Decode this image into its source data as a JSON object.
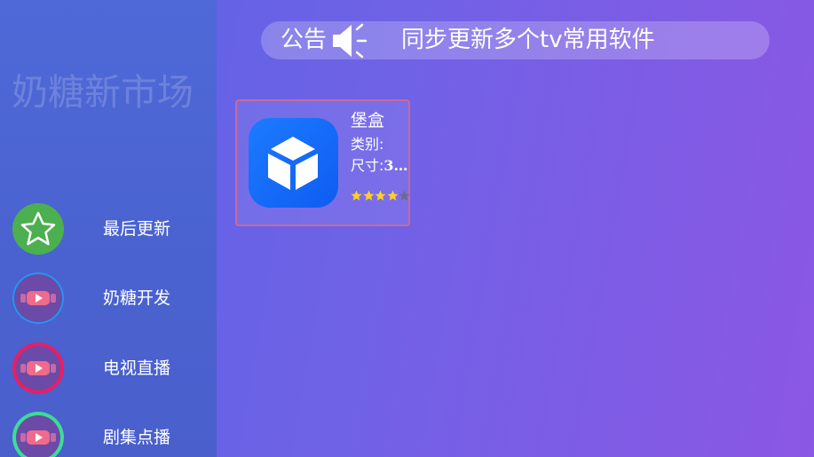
{
  "sidebar": {
    "store_title": "奶糖新市场",
    "items": [
      {
        "label": "最后更新",
        "icon": "star-icon",
        "ring": "#4caf50"
      },
      {
        "label": "奶糖开发",
        "icon": "video-play-icon",
        "ring": "#2196f3"
      },
      {
        "label": "电视直播",
        "icon": "video-play-icon",
        "ring": "#e91e63"
      },
      {
        "label": "剧集点播",
        "icon": "video-play-icon",
        "ring": "#3ddc97"
      }
    ]
  },
  "notice": {
    "label": "公告",
    "icon": "speaker-icon",
    "text": "同步更新多个tv常用软件"
  },
  "apps": [
    {
      "name": "堡盒",
      "category_label": "类别:",
      "size_label": "尺寸:",
      "size_value": "3…",
      "icon": "cube-icon",
      "rating": 4,
      "rating_max": 5
    }
  ],
  "colors": {
    "accent_star": "#ffd21f",
    "card_border": "#c86a9c",
    "app_icon_blue": "#1c7bff"
  }
}
